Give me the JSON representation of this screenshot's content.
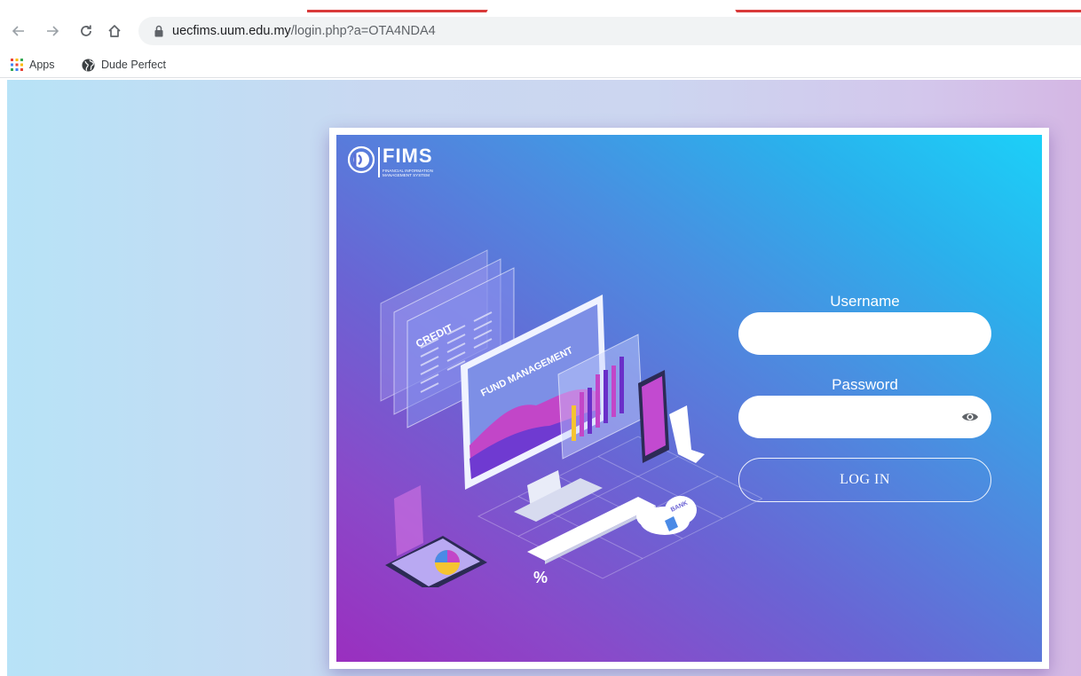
{
  "browser": {
    "url_host": "uecfims.uum.edu.my",
    "url_path": "/login.php?a=OTA4NDA4",
    "back_icon": "back-arrow-icon",
    "forward_icon": "forward-arrow-icon",
    "reload_icon": "reload-icon",
    "home_icon": "home-icon",
    "lock_icon": "lock-icon",
    "bookmarks": [
      {
        "label": "Apps",
        "icon": "apps-grid-icon"
      },
      {
        "label": "Dude Perfect",
        "icon": "globe-icon"
      }
    ]
  },
  "login": {
    "logo_title": "FIMS",
    "logo_subtitle_line1": "FINANCIAL INFORMATION",
    "logo_subtitle_line2": "MANAGEMENT SYSTEM",
    "illustration_texts": {
      "credit": "CREDIT",
      "fund_management": "FUND MANAGEMENT",
      "bank": "BANK",
      "percent": "%"
    },
    "username_label": "Username",
    "username_value": "",
    "password_label": "Password",
    "password_value": "",
    "password_toggle_icon": "eye-icon",
    "login_button_label": "LOG IN"
  },
  "colors": {
    "accent_red": "#d93a3a",
    "hero_start": "#9a2fbf",
    "hero_end": "#1cd0f8"
  }
}
